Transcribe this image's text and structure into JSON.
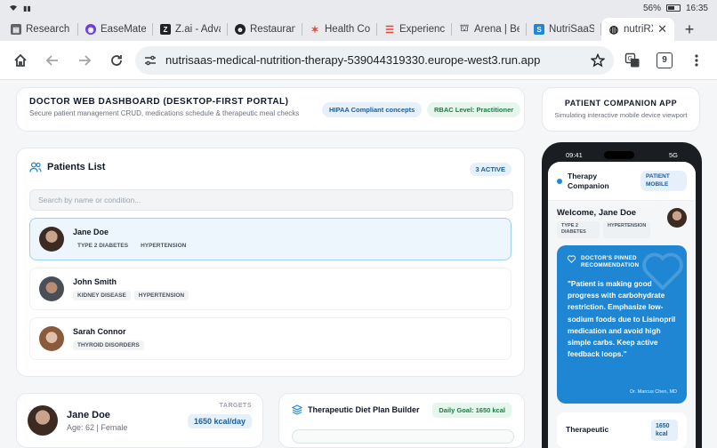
{
  "status": {
    "battery": "56%",
    "time": "16:35"
  },
  "tabs": [
    {
      "title": "Research F",
      "fav_color": "#5f6368",
      "fav": "doc-icon"
    },
    {
      "title": "EaseMate",
      "fav_color": "#6b3fd6",
      "fav": "easemate-icon"
    },
    {
      "title": "Z.ai - Adva",
      "fav_color": "#202124",
      "fav": "z-icon"
    },
    {
      "title": "Restaurant",
      "fav_color": "#202124",
      "fav": "face-icon"
    },
    {
      "title": "Health Cor",
      "fav_color": "#ea4335",
      "fav": "health-icon"
    },
    {
      "title": "Experience",
      "fav_color": "#ea4335",
      "fav": "lines-icon"
    },
    {
      "title": "Arena | Be",
      "fav_color": "#5f6368",
      "fav": "arena-icon"
    },
    {
      "title": "NutriSaaS",
      "fav_color": "#1e88d8",
      "fav": "s-icon"
    },
    {
      "title": "nutriRX",
      "fav_color": "#202124",
      "fav": "globe-icon",
      "active": true
    }
  ],
  "address": {
    "url": "nutrisaas-medical-nutrition-therapy-539044319330.europe-west3.run.app",
    "tab_count": "9"
  },
  "dashboard": {
    "title": "DOCTOR WEB DASHBOARD (DESKTOP-FIRST PORTAL)",
    "subtitle": "Secure patient management CRUD, medications schedule & therapeutic meal checks",
    "hipaa": "HIPAA Compliant concepts",
    "rbac": "RBAC Level: Practitioner"
  },
  "companion": {
    "title": "PATIENT COMPANION APP",
    "subtitle": "Simulating interactive mobile device viewport"
  },
  "patients": {
    "heading": "Patients List",
    "active_badge": "3 ACTIVE",
    "search_placeholder": "Search by name or condition...",
    "rows": [
      {
        "name": "Jane Doe",
        "tags": [
          "TYPE 2 DIABETES",
          "HYPERTENSION"
        ]
      },
      {
        "name": "John Smith",
        "tags": [
          "KIDNEY DISEASE",
          "HYPERTENSION"
        ]
      },
      {
        "name": "Sarah Connor",
        "tags": [
          "THYROID DISORDERS"
        ]
      }
    ]
  },
  "profile": {
    "name": "Jane Doe",
    "age_line": "Age: 62 | Female",
    "targets_label": "TARGETS",
    "targets_value": "1650 kcal/day"
  },
  "diet": {
    "title": "Therapeutic Diet Plan Builder",
    "goal": "Daily Goal: 1650 kcal"
  },
  "phone": {
    "time": "09:41",
    "net": "5G",
    "app_title": "Therapy Companion",
    "mode": "PATIENT MOBILE",
    "welcome": "Welcome, Jane Doe",
    "tags": [
      "TYPE 2 DIABETES",
      "HYPERTENSION"
    ],
    "reco_label": "DOCTOR'S PINNED RECOMMENDATION",
    "reco_text": "\"Patient is making good progress with carbohydrate restriction. Emphasize low-sodium foods due to Lisinopril medication and avoid high simple carbs. Keep active feedback loops.\"",
    "reco_by": "Dr. Marcus Chen, MD",
    "therapy_title": "Therapeutic",
    "therapy_kcal": "1650 kcal"
  }
}
